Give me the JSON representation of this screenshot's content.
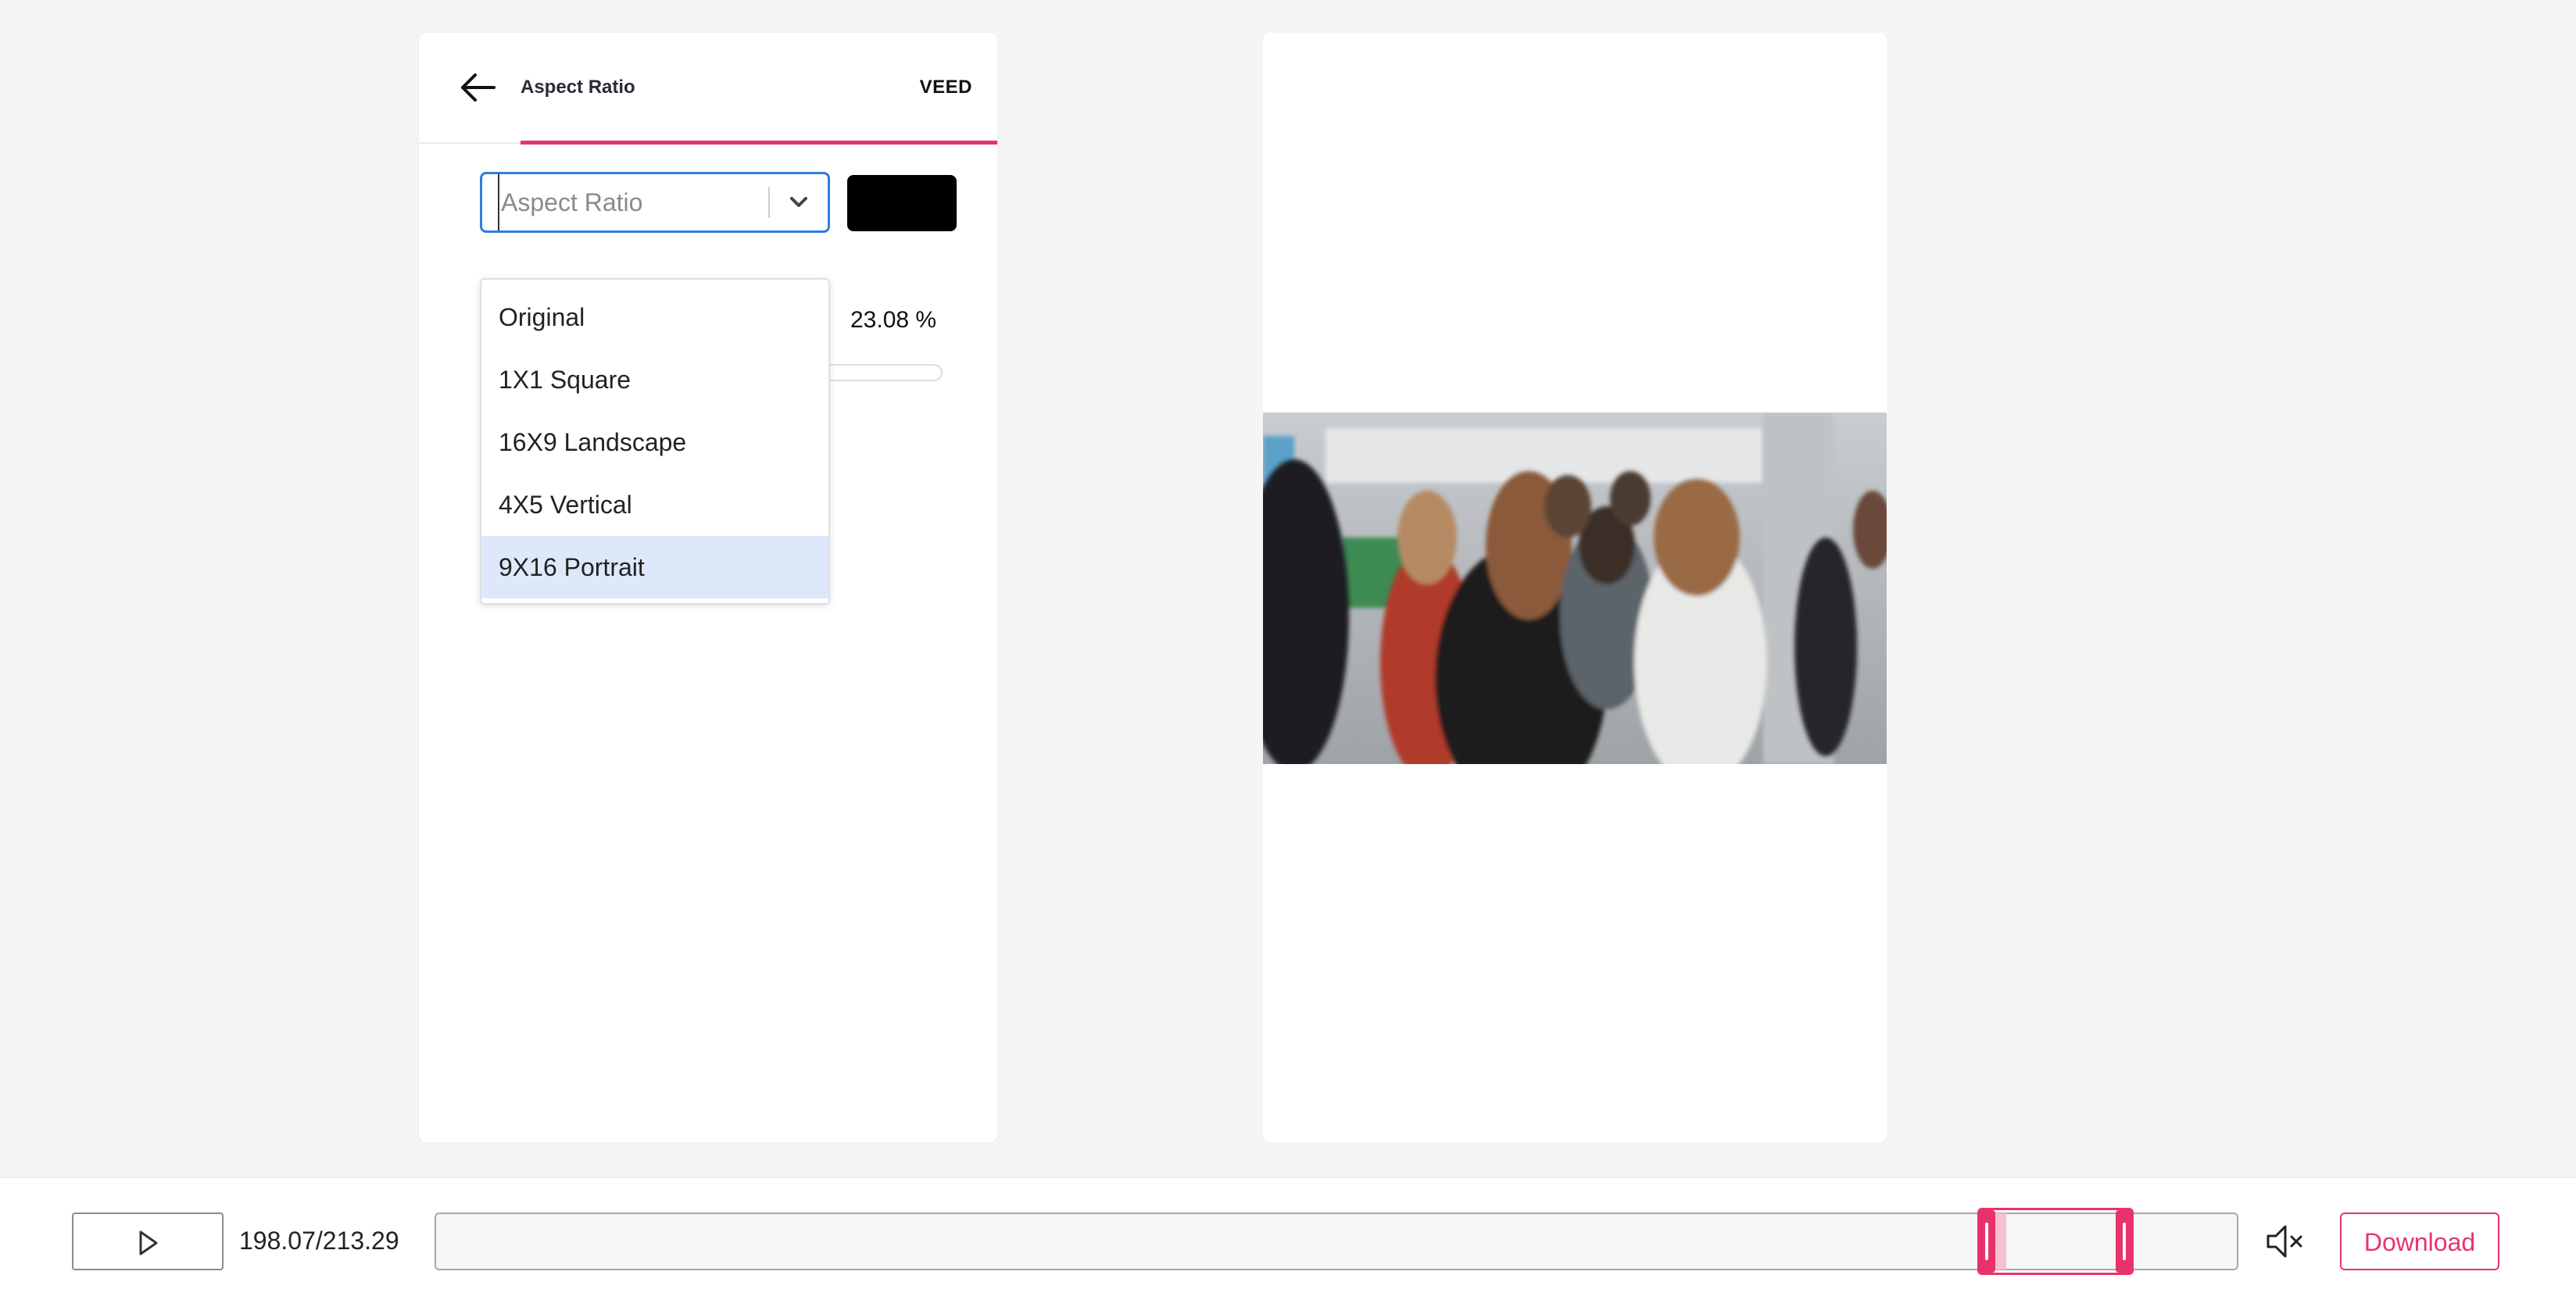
{
  "header": {
    "title": "Aspect Ratio",
    "brand": "VEED",
    "back_icon": "arrow-left-icon"
  },
  "aspect_select": {
    "placeholder": "Aspect Ratio",
    "value": "",
    "chevron_icon": "chevron-down-icon",
    "options": [
      "Original",
      "1X1 Square",
      "16X9 Landscape",
      "4X5 Vertical",
      "9X16 Portrait"
    ],
    "highlighted": "9X16 Portrait"
  },
  "background_color": "#000000",
  "zoom": {
    "value_text": "23.08 %"
  },
  "preview": {
    "image": "people-in-office-photo"
  },
  "player": {
    "play_icon": "play-icon",
    "time": "198.07/213.29",
    "mute_icon": "volume-muted-icon",
    "download_label": "Download"
  },
  "colors": {
    "accent": "#e8336a",
    "focus": "#2f7de1",
    "highlight": "#dde9fb"
  }
}
